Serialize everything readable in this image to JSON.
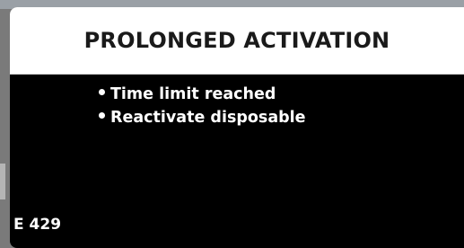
{
  "dialog": {
    "title": "PROLONGED ACTIVATION",
    "messages": [
      "Time limit reached",
      "Reactivate disposable"
    ],
    "error_code": "E 429"
  },
  "colors": {
    "header_bg": "#ffffff",
    "body_bg": "#000000",
    "text_light": "#ffffff",
    "text_dark": "#1a1a1a"
  }
}
